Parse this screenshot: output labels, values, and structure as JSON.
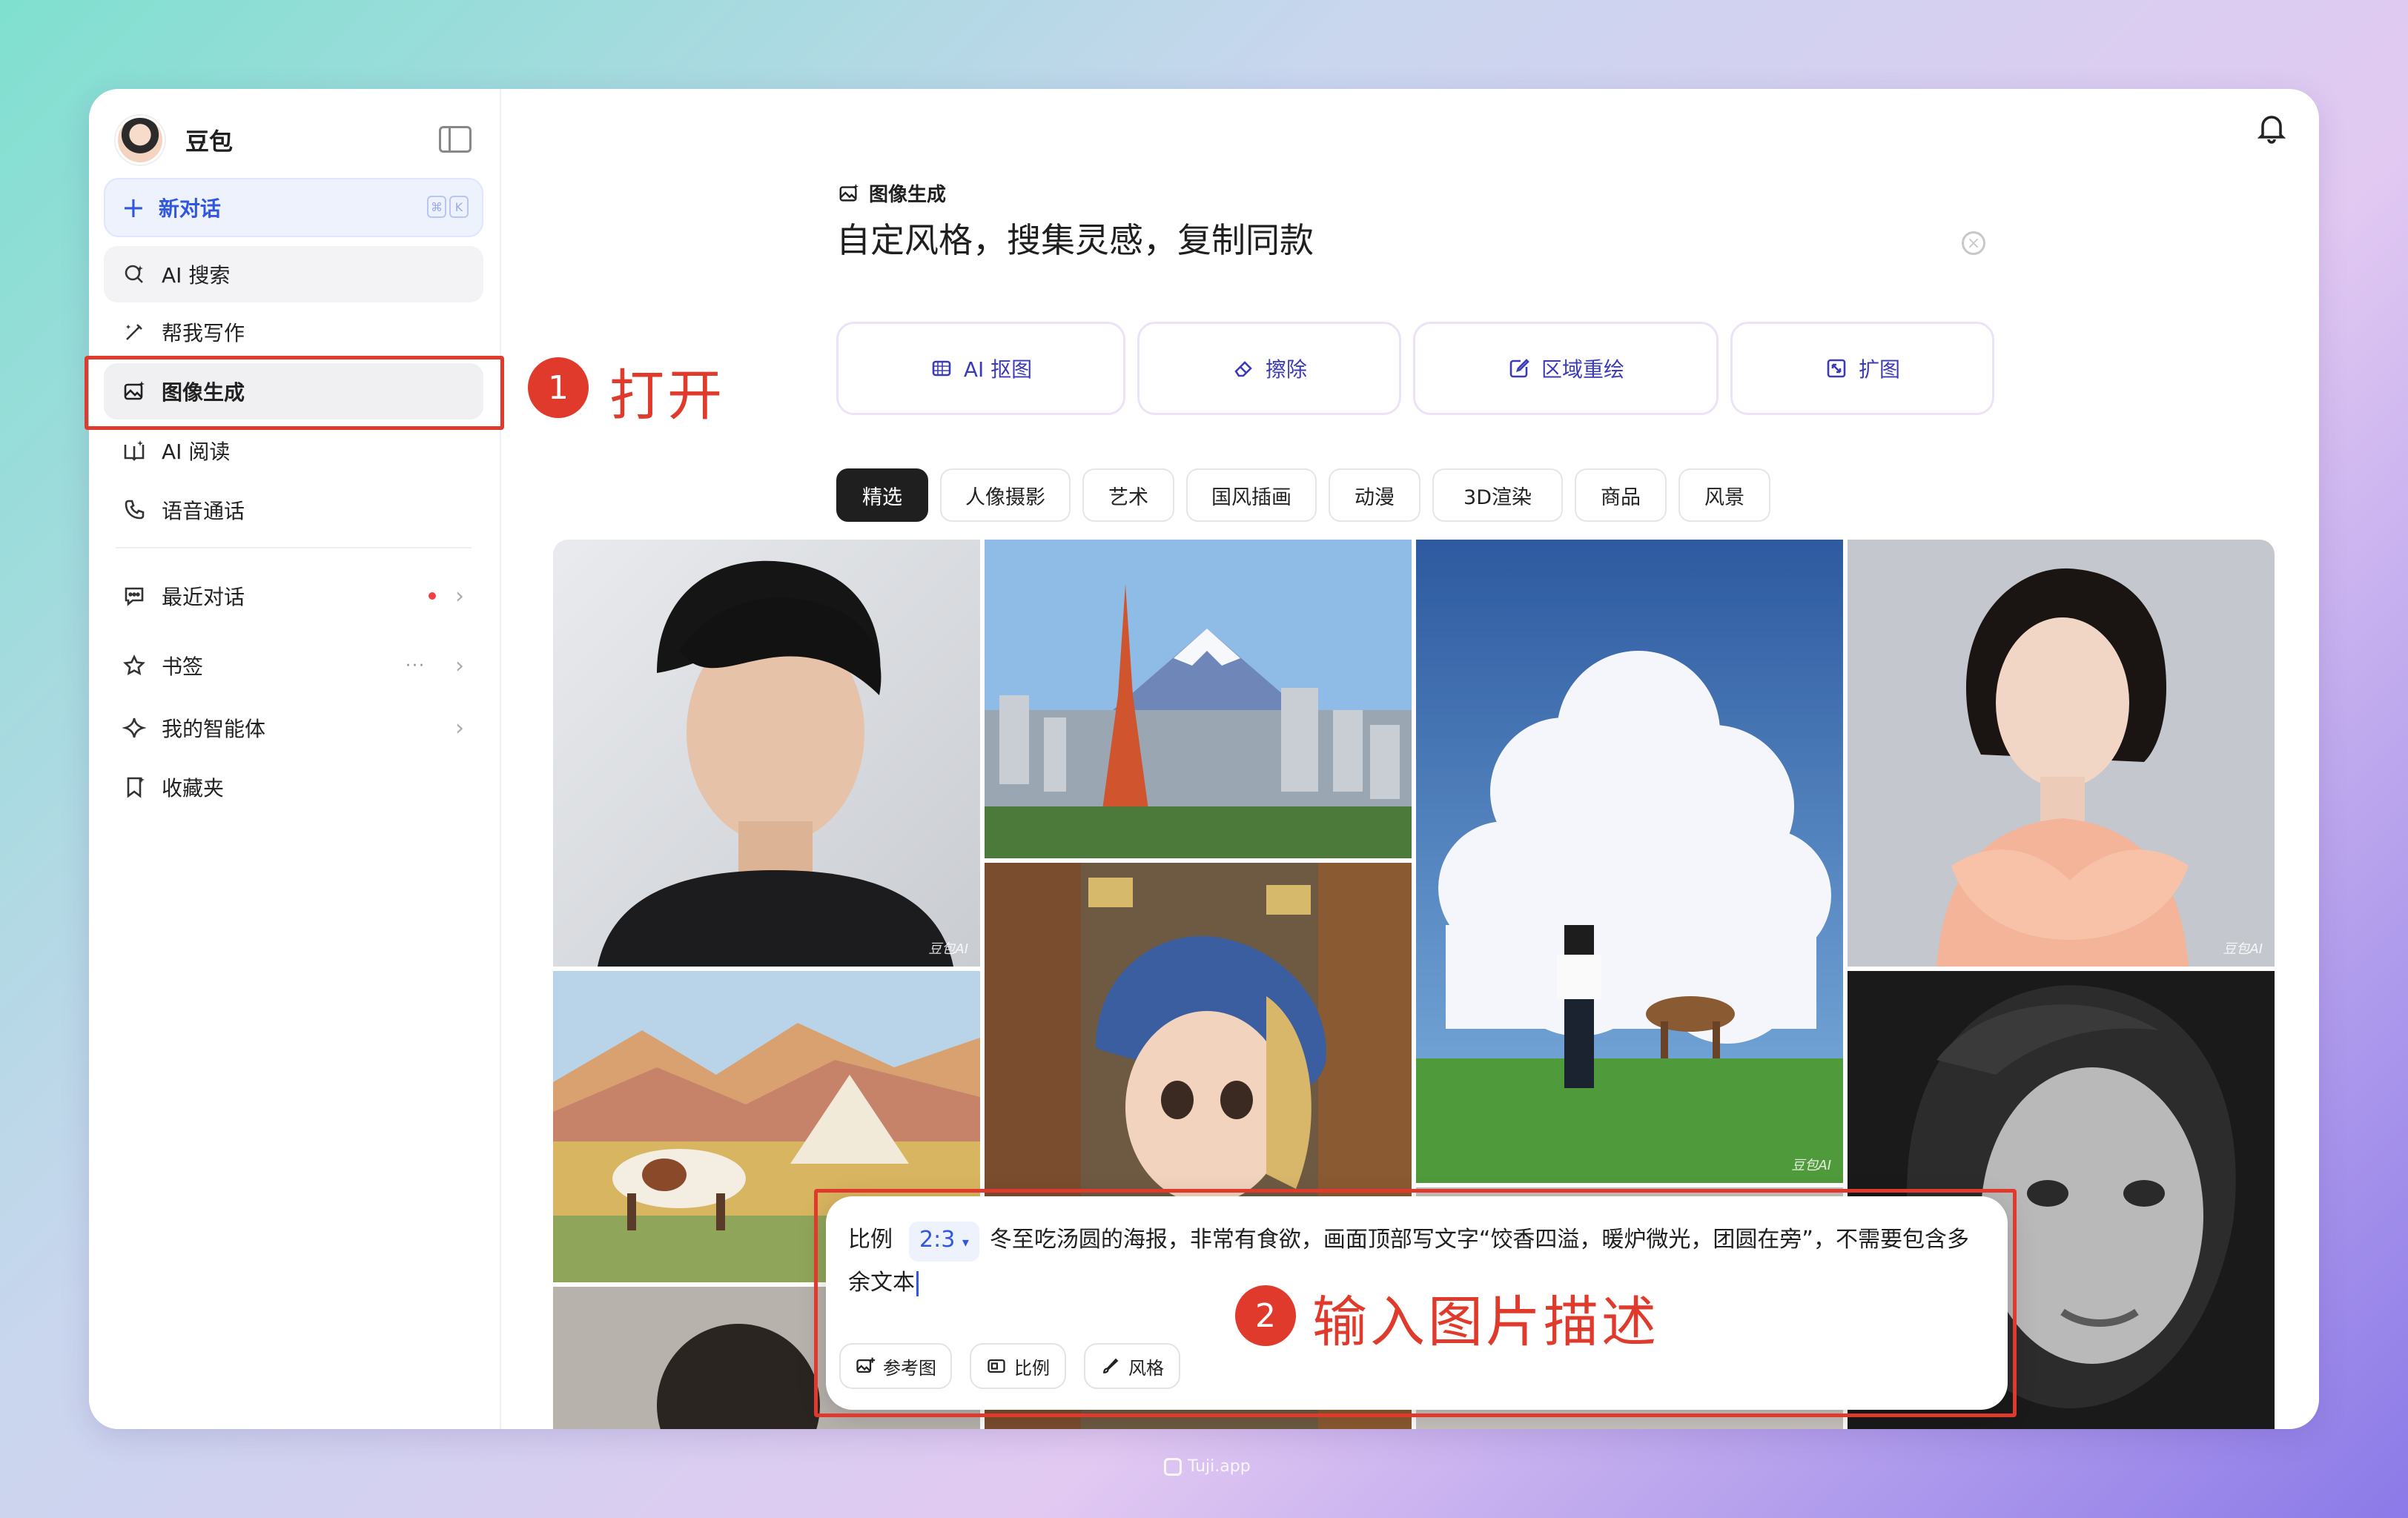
{
  "app": {
    "brand_name": "豆包",
    "new_chat_label": "新对话",
    "shortcut_keys": [
      "⌘",
      "K"
    ]
  },
  "sidebar": {
    "items": [
      {
        "label": "AI 搜索",
        "icon": "ai-search-icon"
      },
      {
        "label": "帮我写作",
        "icon": "magic-pen-icon"
      },
      {
        "label": "图像生成",
        "icon": "image-generate-icon"
      },
      {
        "label": "AI 阅读",
        "icon": "book-icon"
      },
      {
        "label": "语音通话",
        "icon": "phone-icon"
      }
    ],
    "sections": [
      {
        "label": "最近对话",
        "icon": "chat-bubble-icon"
      },
      {
        "label": "书签",
        "icon": "star-icon",
        "more": "···"
      },
      {
        "label": "我的智能体",
        "icon": "sparkle-icon"
      },
      {
        "label": "收藏夹",
        "icon": "bookmark-icon"
      }
    ]
  },
  "main": {
    "mode_title": "图像生成",
    "headline": "自定风格，搜集灵感，复制同款",
    "tools": [
      {
        "label": "AI 抠图",
        "icon": "cutout-icon"
      },
      {
        "label": "擦除",
        "icon": "eraser-icon"
      },
      {
        "label": "区域重绘",
        "icon": "brush-icon"
      },
      {
        "label": "扩图",
        "icon": "expand-icon"
      }
    ],
    "categories": [
      "精选",
      "人像摄影",
      "艺术",
      "国风插画",
      "动漫",
      "3D渲染",
      "商品",
      "风景"
    ],
    "active_category": "精选",
    "watermark": "豆包AI"
  },
  "prompt": {
    "ratio_label": "比例",
    "ratio_value": "2:3",
    "text": "冬至吃汤圆的海报，非常有食欲，画面顶部写文字“饺香四溢，暖炉微光，团圆在旁”，不需要包含多余文本",
    "buttons": {
      "reference": "参考图",
      "ratio": "比例",
      "style": "风格"
    }
  },
  "annotations": {
    "step1_num": "1",
    "step1_text": "打开",
    "step2_num": "2",
    "step2_text": "输入图片描述"
  },
  "footer": {
    "brand": "Tuji.app"
  },
  "colors": {
    "accent": "#3157e0",
    "send_button": "#3a6cf5",
    "annotation_red": "#e03a2c",
    "tool_text": "#3b3bb8"
  }
}
